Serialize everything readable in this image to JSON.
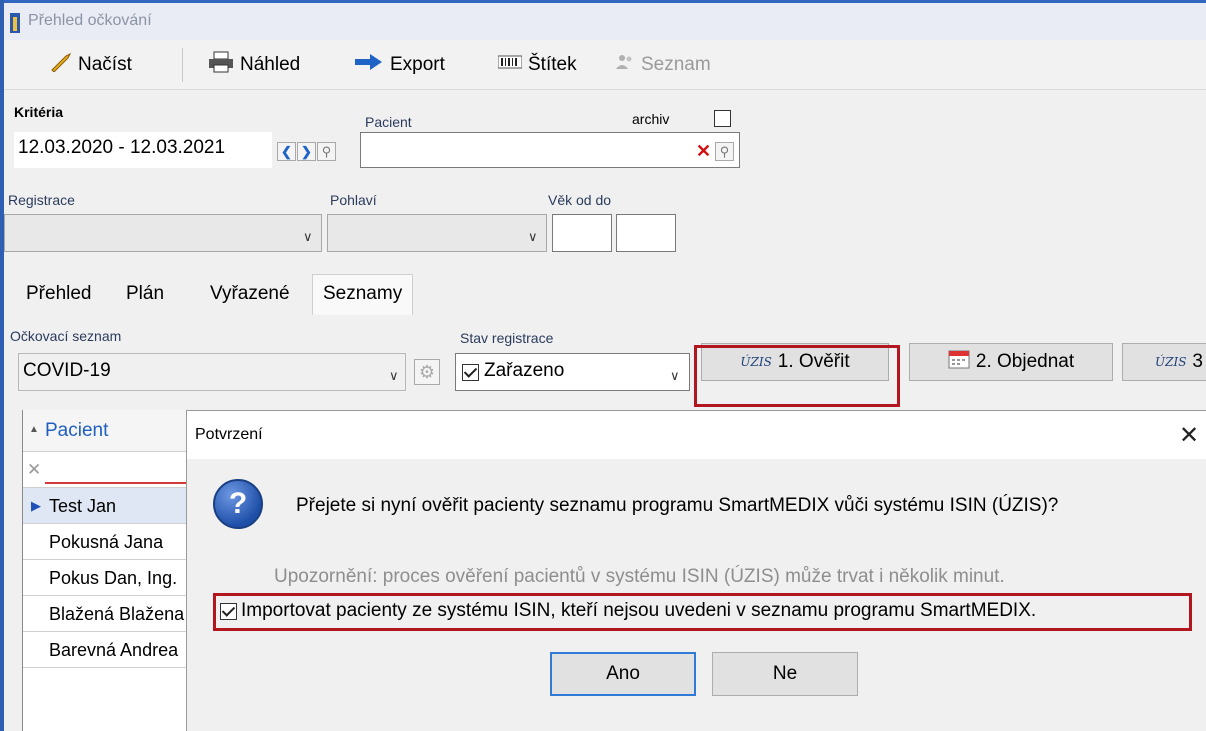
{
  "window": {
    "title": "Přehled očkování"
  },
  "toolbar": {
    "nacist": "Načíst",
    "nahled": "Náhled",
    "export": "Export",
    "stitek": "Štítek",
    "seznam": "Seznam"
  },
  "criteria": {
    "heading": "Kritéria",
    "date_range": "12.03.2020 - 12.03.2021",
    "pacient_label": "Pacient",
    "pacient_value": "",
    "archiv_label": "archiv",
    "archiv_checked": false,
    "registrace_label": "Registrace",
    "pohlavi_label": "Pohlaví",
    "vek_label": "Věk od do"
  },
  "tabs": [
    "Přehled",
    "Plán",
    "Vyřazené",
    "Seznamy"
  ],
  "active_tab": "Seznamy",
  "seznamy": {
    "ockovaci_label": "Očkovací seznam",
    "ockovaci_value": "COVID-19",
    "stav_label": "Stav registrace",
    "stav_value": "Zařazeno",
    "uzis_logo": "ÚZIS",
    "btn_overit": "1. Ověřit",
    "btn_objednat": "2. Objednat",
    "btn_third": "3"
  },
  "grid": {
    "column": "Pacient",
    "rows": [
      "Test Jan",
      "Pokusná Jana",
      "Pokus Dan, Ing.",
      "Blažená  Blažena",
      "Barevná Andrea"
    ],
    "selected_index": 0
  },
  "dialog": {
    "title": "Potvrzení",
    "message": "Přejete si nyní ověřit pacienty seznamu programu SmartMEDIX vůči systému ISIN (ÚZIS)?",
    "note": "Upozornění: proces ověření pacientů v systému ISIN (ÚZIS) může trvat i několik minut.",
    "import_label": "Importovat pacienty ze systému ISIN, kteří nejsou uvedeni v seznamu programu SmartMEDIX.",
    "import_checked": true,
    "yes": "Ano",
    "no": "Ne"
  },
  "colors": {
    "highlight": "#b3161e",
    "accent": "#2f5fb3"
  }
}
